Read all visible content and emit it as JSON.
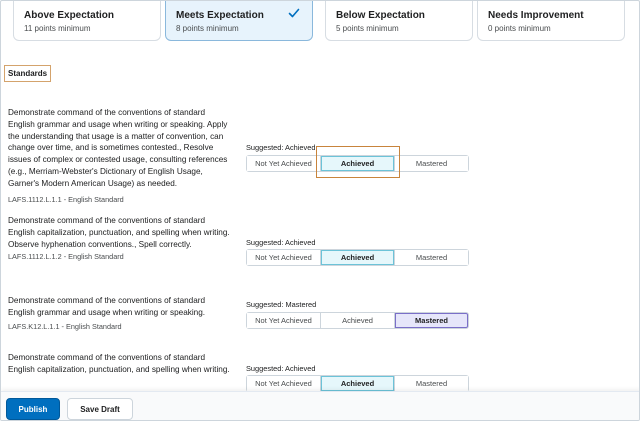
{
  "levels": [
    {
      "name": "Above Expectation",
      "points": "11 points minimum",
      "selected": false
    },
    {
      "name": "Meets Expectation",
      "points": "8 points minimum",
      "selected": true
    },
    {
      "name": "Below Expectation",
      "points": "5 points minimum",
      "selected": false
    },
    {
      "name": "Needs Improvement",
      "points": "0 points minimum",
      "selected": false
    }
  ],
  "standards_heading": "Standards",
  "options": [
    "Not Yet Achieved",
    "Achieved",
    "Mastered"
  ],
  "criteria": [
    {
      "text": "Demonstrate command of the conventions of standard English grammar and usage when writing or speaking. Apply the understanding that usage is a matter of convention, can change over time, and is sometimes contested., Resolve issues of complex or contested usage, consulting references (e.g., Merriam-Webster's Dictionary of English Usage, Garner's Modern American Usage) as needed.",
      "code": "LAFS.1112.L.1.1 - English Standard",
      "suggested": "Suggested: Achieved",
      "selected": "Achieved"
    },
    {
      "text": "Demonstrate command of the conventions of standard English capitalization, punctuation, and spelling when writing. Observe hyphenation conventions., Spell correctly.",
      "code": "LAFS.1112.L.1.2 - English Standard",
      "suggested": "Suggested: Achieved",
      "selected": "Achieved"
    },
    {
      "text": "Demonstrate command of the conventions of standard English grammar and usage when writing or speaking.",
      "code": "LAFS.K12.L.1.1 - English Standard",
      "suggested": "Suggested: Mastered",
      "selected": "Mastered"
    },
    {
      "text": "Demonstrate command of the conventions of standard English capitalization, punctuation, and spelling when writing.",
      "code": "",
      "suggested": "Suggested: Achieved",
      "selected": "Achieved"
    }
  ],
  "footer": {
    "publish_label": "Publish",
    "save_draft_label": "Save Draft"
  },
  "colors": {
    "primary": "#006fbf",
    "achieved": "#6cc3d8",
    "mastered": "#7a6fc8",
    "selected_card": "#e7f3fc"
  }
}
